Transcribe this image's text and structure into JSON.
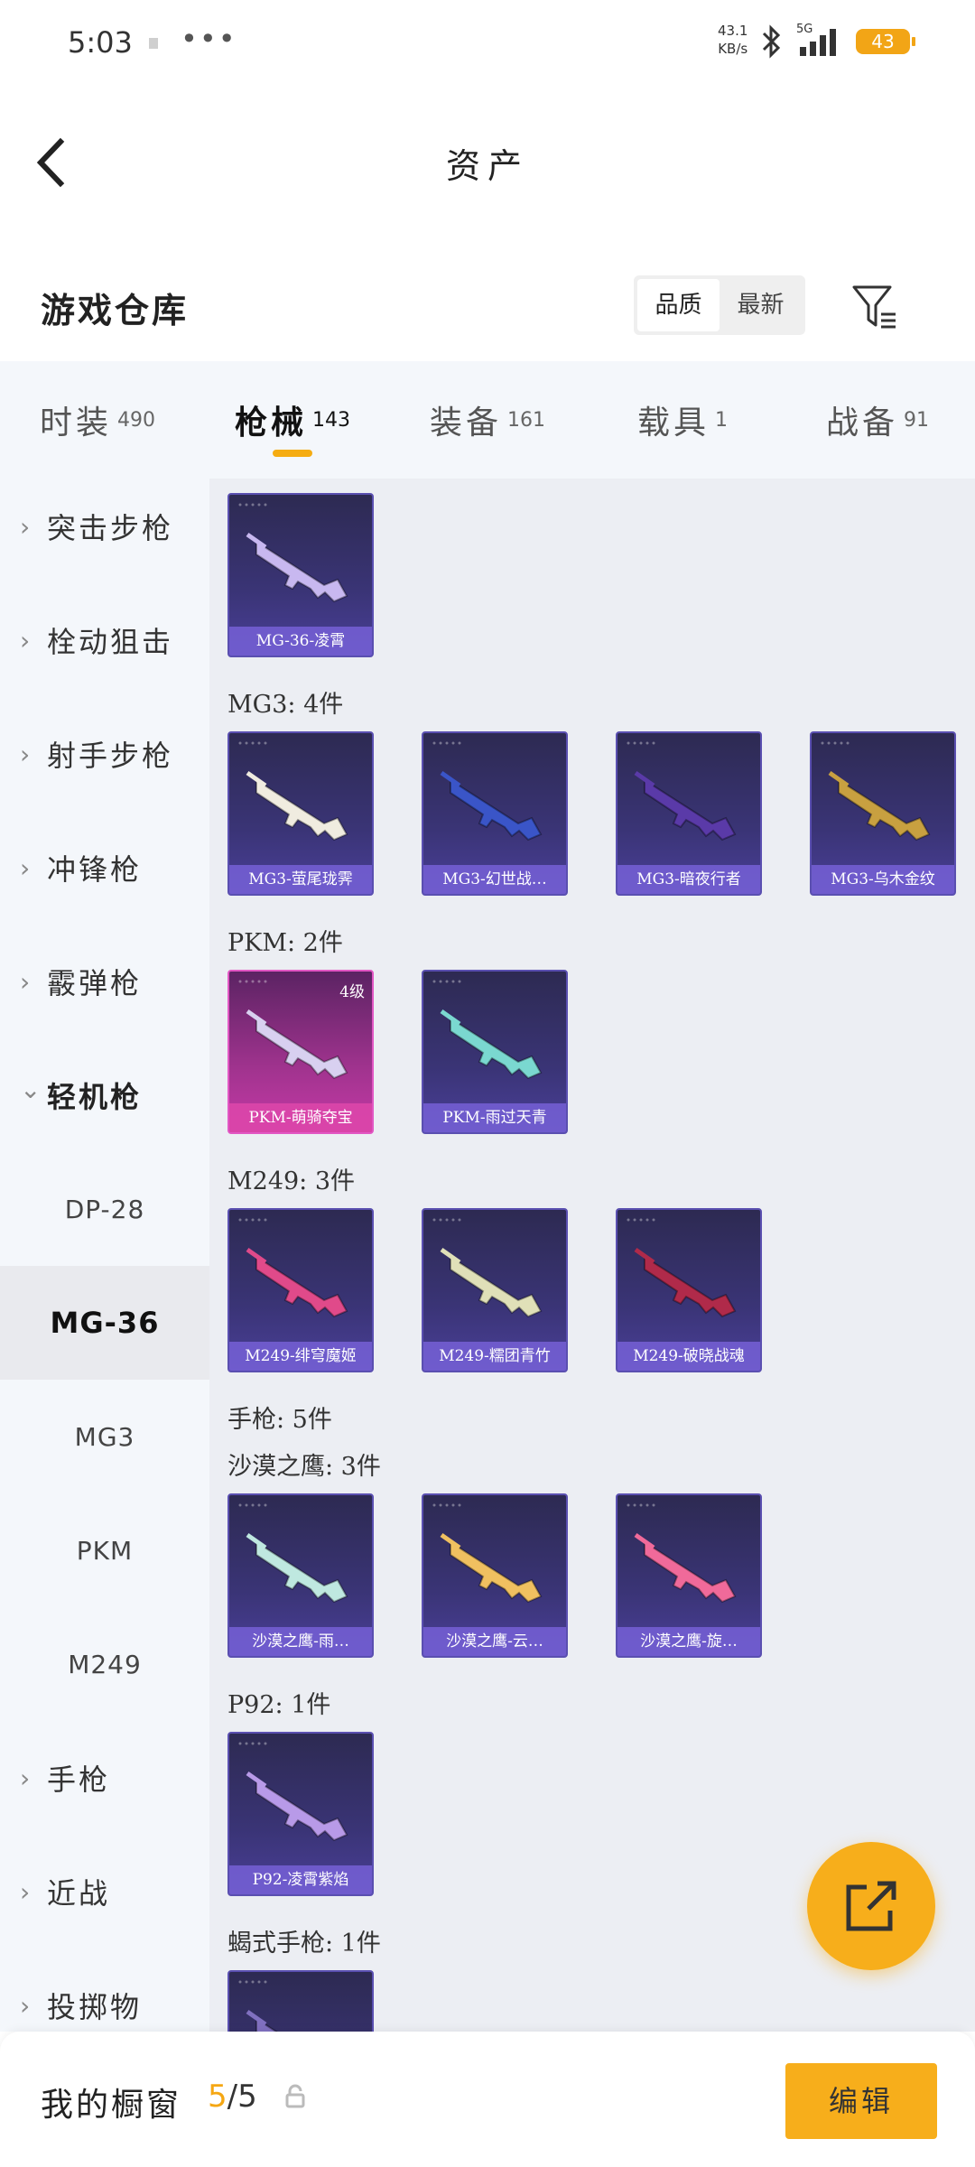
{
  "status": {
    "time": "5:03",
    "dots": "•••",
    "speed_value": "43.1",
    "speed_unit": "KB/s",
    "network": "5G",
    "battery": "43"
  },
  "header": {
    "title": "资产"
  },
  "warehouse": {
    "title": "游戏仓库",
    "sort_options": [
      "品质",
      "最新"
    ],
    "active_sort": "品质"
  },
  "tabs": [
    {
      "label": "时装",
      "count": "490",
      "active": false
    },
    {
      "label": "枪械",
      "count": "143",
      "active": true
    },
    {
      "label": "装备",
      "count": "161",
      "active": false
    },
    {
      "label": "载具",
      "count": "1",
      "active": false
    },
    {
      "label": "战备",
      "count": "91",
      "active": false
    }
  ],
  "sidebar": {
    "items": [
      {
        "label": "突击步枪",
        "type": "category",
        "state": "collapsed"
      },
      {
        "label": "栓动狙击",
        "type": "category",
        "state": "collapsed"
      },
      {
        "label": "射手步枪",
        "type": "category",
        "state": "collapsed"
      },
      {
        "label": "冲锋枪",
        "type": "category",
        "state": "collapsed"
      },
      {
        "label": "霰弹枪",
        "type": "category",
        "state": "collapsed"
      },
      {
        "label": "轻机枪",
        "type": "category",
        "state": "expanded"
      },
      {
        "label": "DP-28",
        "type": "sub"
      },
      {
        "label": "MG-36",
        "type": "sub",
        "selected": true
      },
      {
        "label": "MG3",
        "type": "sub"
      },
      {
        "label": "PKM",
        "type": "sub"
      },
      {
        "label": "M249",
        "type": "sub"
      },
      {
        "label": "手枪",
        "type": "category",
        "state": "collapsed"
      },
      {
        "label": "近战",
        "type": "category",
        "state": "collapsed"
      },
      {
        "label": "投掷物",
        "type": "category",
        "state": "collapsed"
      }
    ]
  },
  "content": {
    "groups": [
      {
        "title": "",
        "items": [
          {
            "name": "MG-36-凌霄",
            "color": "#c8b8f0"
          }
        ]
      },
      {
        "title": "MG3: 4件",
        "items": [
          {
            "name": "MG3-萤尾珑霁",
            "color": "#f0ece0"
          },
          {
            "name": "MG3-幻世战…",
            "color": "#3a55c8"
          },
          {
            "name": "MG3-暗夜行者",
            "color": "#5a3aa8"
          },
          {
            "name": "MG3-乌木金纹",
            "color": "#c8a040"
          }
        ]
      },
      {
        "title": "PKM: 2件",
        "items": [
          {
            "name": "PKM-萌骑夺宝",
            "color": "#d8d0f0",
            "level": "4级",
            "pink": true
          },
          {
            "name": "PKM-雨过天青",
            "color": "#7ad8d0"
          }
        ]
      },
      {
        "title": "M249: 3件",
        "items": [
          {
            "name": "M249-绯穹魔姬",
            "color": "#e04a8a"
          },
          {
            "name": "M249-糯团青竹",
            "color": "#e0e0b8"
          },
          {
            "name": "M249-破晓战魂",
            "color": "#b02a4a"
          }
        ]
      },
      {
        "title": "手枪: 5件",
        "items": []
      },
      {
        "title": "沙漠之鹰: 3件",
        "items": [
          {
            "name": "沙漠之鹰-雨…",
            "color": "#bfe8e0"
          },
          {
            "name": "沙漠之鹰-云…",
            "color": "#f0c060"
          },
          {
            "name": "沙漠之鹰-旋…",
            "color": "#f06a9a"
          }
        ]
      },
      {
        "title": "P92: 1件",
        "items": [
          {
            "name": "P92-凌霄紫焰",
            "color": "#b89ae8"
          }
        ]
      },
      {
        "title": "蝎式手枪: 1件",
        "items": [
          {
            "name": "",
            "color": "#8070c0"
          }
        ]
      }
    ]
  },
  "bottom": {
    "title": "我的橱窗",
    "count_current": "5",
    "count_total": "/5",
    "edit_label": "编辑"
  },
  "colors": {
    "accent": "#f7ae1b",
    "card_bg": "#3a3476",
    "card_label": "#7660d6",
    "pink_card": "#c53aa6"
  }
}
